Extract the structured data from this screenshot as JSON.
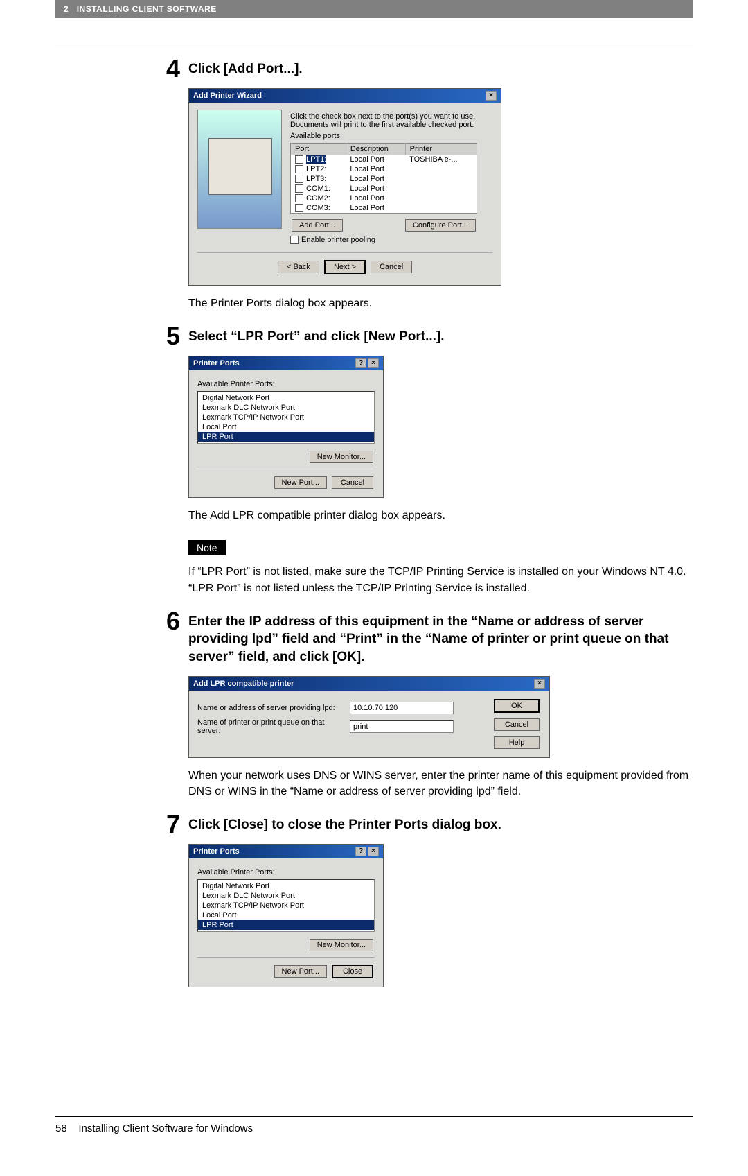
{
  "header": {
    "chapter_num": "2",
    "chapter_title": "INSTALLING CLIENT SOFTWARE"
  },
  "step4": {
    "num": "4",
    "title": "Click [Add Port...].",
    "caption": "The Printer Ports dialog box appears.",
    "dialog": {
      "title": "Add Printer Wizard",
      "instruction": "Click the check box next to the port(s) you want to use. Documents will print to the first available checked port.",
      "list_label": "Available ports:",
      "headers": {
        "port": "Port",
        "desc": "Description",
        "printer": "Printer"
      },
      "rows": [
        {
          "port": "LPT1:",
          "desc": "Local Port",
          "printer": "TOSHIBA e-...",
          "checked": true,
          "selected": true
        },
        {
          "port": "LPT2:",
          "desc": "Local Port",
          "printer": ""
        },
        {
          "port": "LPT3:",
          "desc": "Local Port",
          "printer": ""
        },
        {
          "port": "COM1:",
          "desc": "Local Port",
          "printer": ""
        },
        {
          "port": "COM2:",
          "desc": "Local Port",
          "printer": ""
        },
        {
          "port": "COM3:",
          "desc": "Local Port",
          "printer": ""
        }
      ],
      "add_port_btn": "Add Port...",
      "configure_btn": "Configure Port...",
      "pooling_label": "Enable printer pooling",
      "back_btn": "< Back",
      "next_btn": "Next >",
      "cancel_btn": "Cancel"
    }
  },
  "step5": {
    "num": "5",
    "title": "Select “LPR Port” and click [New Port...].",
    "caption": "The Add LPR compatible printer dialog box appears.",
    "dialog": {
      "title": "Printer Ports",
      "list_label": "Available Printer Ports:",
      "items": [
        "Digital Network Port",
        "Lexmark DLC Network Port",
        "Lexmark TCP/IP Network Port",
        "Local Port",
        "LPR Port"
      ],
      "selected_index": 4,
      "new_monitor_btn": "New Monitor...",
      "new_port_btn": "New Port...",
      "cancel_btn": "Cancel"
    },
    "note_label": "Note",
    "note_text": "If “LPR Port” is not listed, make sure the TCP/IP Printing Service is installed on your Windows NT 4.0.  “LPR Port” is not listed unless the TCP/IP Printing Service is installed."
  },
  "step6": {
    "num": "6",
    "title": "Enter the IP address of this equipment in the “Name or address of server providing lpd” field and “Print” in the “Name of printer or print queue on that server” field, and click [OK].",
    "caption": "When your network uses DNS or WINS server, enter the printer name of this equipment provided from DNS or WINS in the “Name or address of server providing lpd” field.",
    "dialog": {
      "title": "Add LPR compatible printer",
      "server_label": "Name or address of server providing lpd:",
      "server_value": "10.10.70.120",
      "queue_label": "Name of printer or print queue on that server:",
      "queue_value": "print",
      "ok_btn": "OK",
      "cancel_btn": "Cancel",
      "help_btn": "Help"
    }
  },
  "step7": {
    "num": "7",
    "title": "Click [Close] to close the Printer Ports dialog box.",
    "dialog": {
      "title": "Printer Ports",
      "list_label": "Available Printer Ports:",
      "items": [
        "Digital Network Port",
        "Lexmark DLC Network Port",
        "Lexmark TCP/IP Network Port",
        "Local Port",
        "LPR Port"
      ],
      "selected_index": 4,
      "new_monitor_btn": "New Monitor...",
      "new_port_btn": "New Port...",
      "close_btn": "Close"
    }
  },
  "footer": {
    "page_num": "58",
    "section": "Installing Client Software for Windows"
  }
}
